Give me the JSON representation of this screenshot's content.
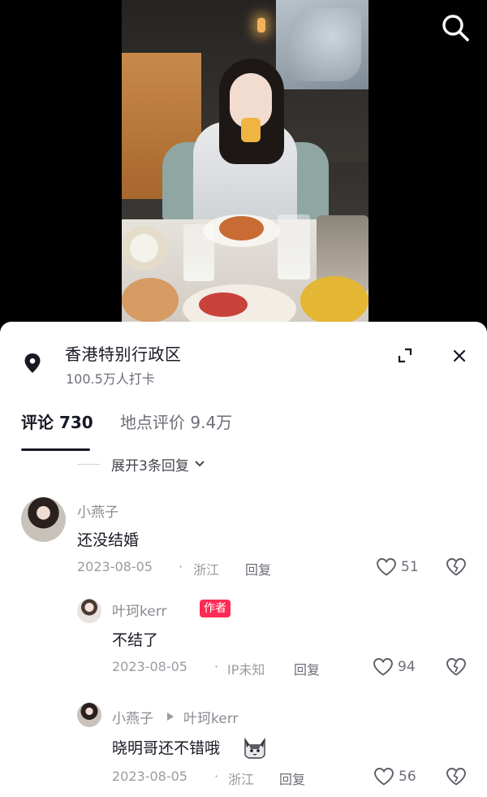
{
  "header": {
    "search_icon": "search-icon"
  },
  "location": {
    "title": "香港特别行政区",
    "checkins": "100.5万人打卡"
  },
  "tabs": [
    {
      "label": "评论 730",
      "active": true
    },
    {
      "label": "地点评价 9.4万",
      "active": false
    }
  ],
  "expand_replies": "展开3条回复",
  "comments": [
    {
      "user": "小燕子",
      "text": "还没结婚",
      "date": "2023-08-05",
      "sep": "·",
      "region": "浙江",
      "reply": "回复",
      "likes": "51"
    },
    {
      "user": "叶珂kerr",
      "badge": "作者",
      "text": "不结了",
      "date": "2023-08-05",
      "sep": "·",
      "region": "IP未知",
      "reply": "回复",
      "likes": "94"
    },
    {
      "user": "小燕子",
      "reply_to": "叶珂kerr",
      "text": "晓明哥还不错哦",
      "date": "2023-08-05",
      "sep": "·",
      "region": "浙江",
      "reply": "回复",
      "likes": "56"
    }
  ],
  "colors": {
    "accent": "#fe2c55",
    "text_primary": "#161823",
    "text_secondary": "#8a8b91"
  }
}
